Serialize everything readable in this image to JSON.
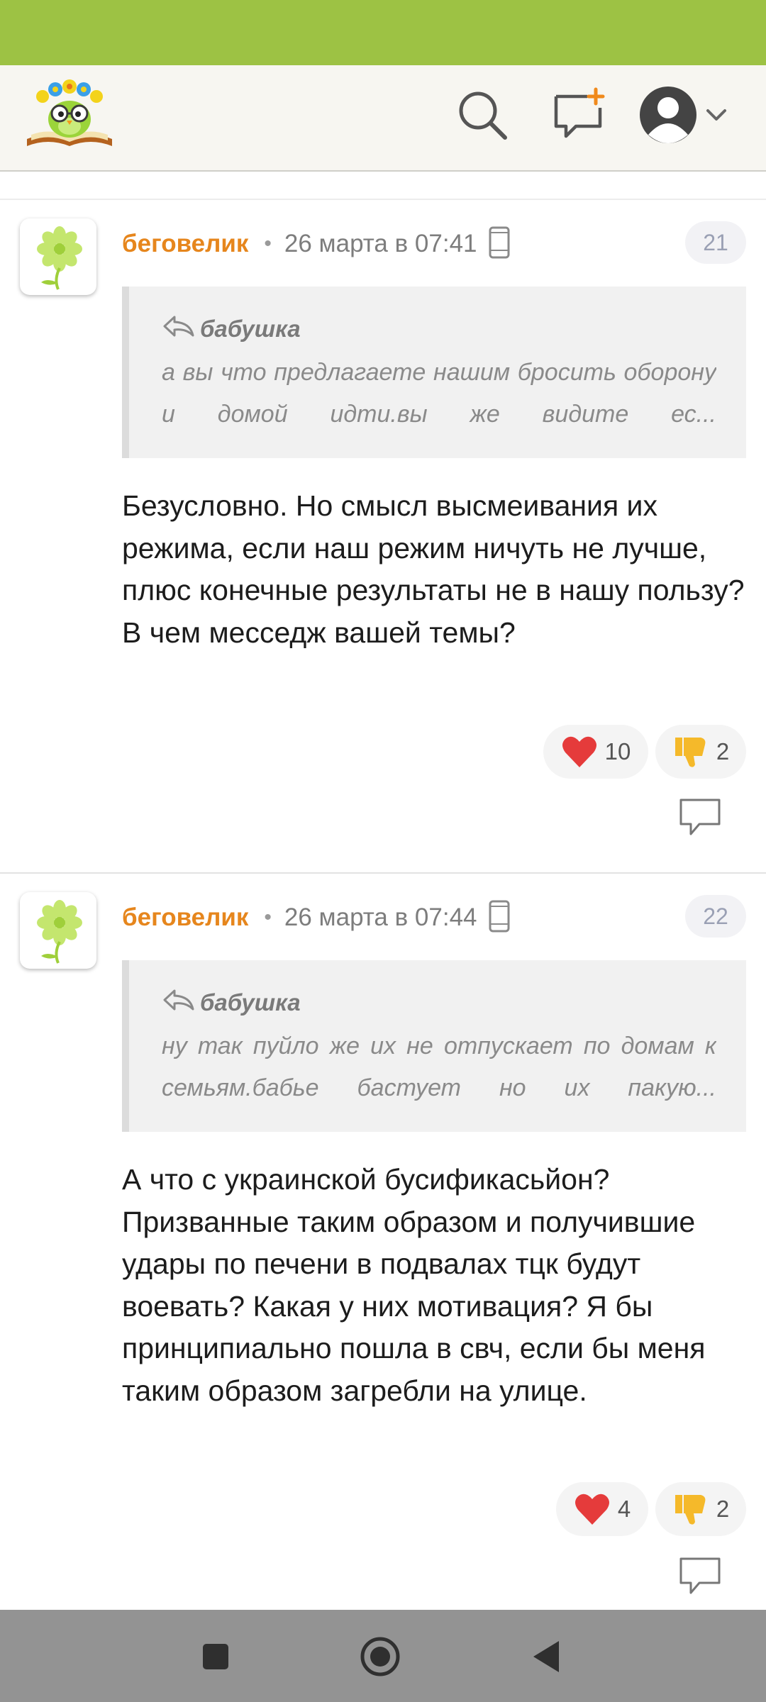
{
  "colors": {
    "status_bar": "#9dc244",
    "author": "#e6861d",
    "heart": "#e53b3b",
    "thumb": "#f5b92a",
    "nav_bar": "#939393"
  },
  "header": {
    "logo": "owl-with-flowers-on-book-logo",
    "icons": [
      "search-icon",
      "new-post-icon",
      "user-avatar-icon",
      "chevron-down-icon"
    ]
  },
  "comments": [
    {
      "author": "беговелик",
      "dot": "•",
      "date": "26 марта в 07:41",
      "number": "21",
      "quote_author": "бабушка",
      "quote_text": "а вы что предлагаете нашим бросить оборону и домой идти.вы же видите ес...",
      "text": "Безусловно. Но смысл высмеивания их режима, если наш режим ничуть не лучше, плюс конечные результаты не в нашу пользу? В чем месседж вашей темы?",
      "likes": "10",
      "dislikes": "2"
    },
    {
      "author": "беговелик",
      "dot": "•",
      "date": "26 марта в 07:44",
      "number": "22",
      "quote_author": "бабушка",
      "quote_text": "ну так пуйло же их не отпускает по домам к семьям.бабье бастует но их пакую...",
      "text": "А что с украинской бусификасьйон? Призванные таким образом и получившие удары по печени в подвалах тцк будут воевать? Какая у них мотивация? Я бы принципиально пошла в свч, если бы меня таким образом загребли на улице.",
      "likes": "4",
      "dislikes": "2"
    }
  ],
  "navbar": {
    "icons": [
      "recents-square-icon",
      "home-circle-icon",
      "back-triangle-icon"
    ]
  }
}
